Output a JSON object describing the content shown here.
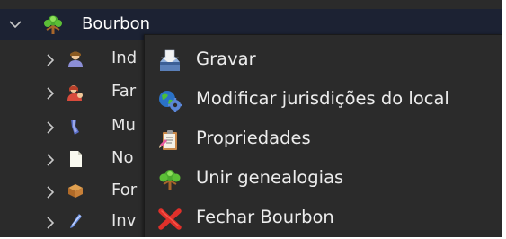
{
  "tree": {
    "root": {
      "label": "Bourbon",
      "icon": "family-tree-icon",
      "expanded": true
    },
    "children": [
      {
        "label": "Ind",
        "icon": "person-icon"
      },
      {
        "label": "Far",
        "icon": "family-icon"
      },
      {
        "label": "Mu",
        "icon": "media-icon"
      },
      {
        "label": "No",
        "icon": "note-icon"
      },
      {
        "label": "For",
        "icon": "source-icon"
      },
      {
        "label": "Inv",
        "icon": "investigation-icon"
      }
    ]
  },
  "context_menu": {
    "items": [
      {
        "label": "Gravar",
        "icon": "save-icon"
      },
      {
        "label": "Modificar jurisdições do local",
        "icon": "globe-gear-icon"
      },
      {
        "label": "Propriedades",
        "icon": "properties-icon"
      },
      {
        "label": "Unir genealogias",
        "icon": "merge-tree-icon"
      },
      {
        "label": "Fechar Bourbon",
        "icon": "close-icon"
      }
    ]
  },
  "colors": {
    "background": "#2b2b2b",
    "selected_row": "#1c2233",
    "text": "#e6e6e6",
    "close_red": "#e0302a"
  }
}
